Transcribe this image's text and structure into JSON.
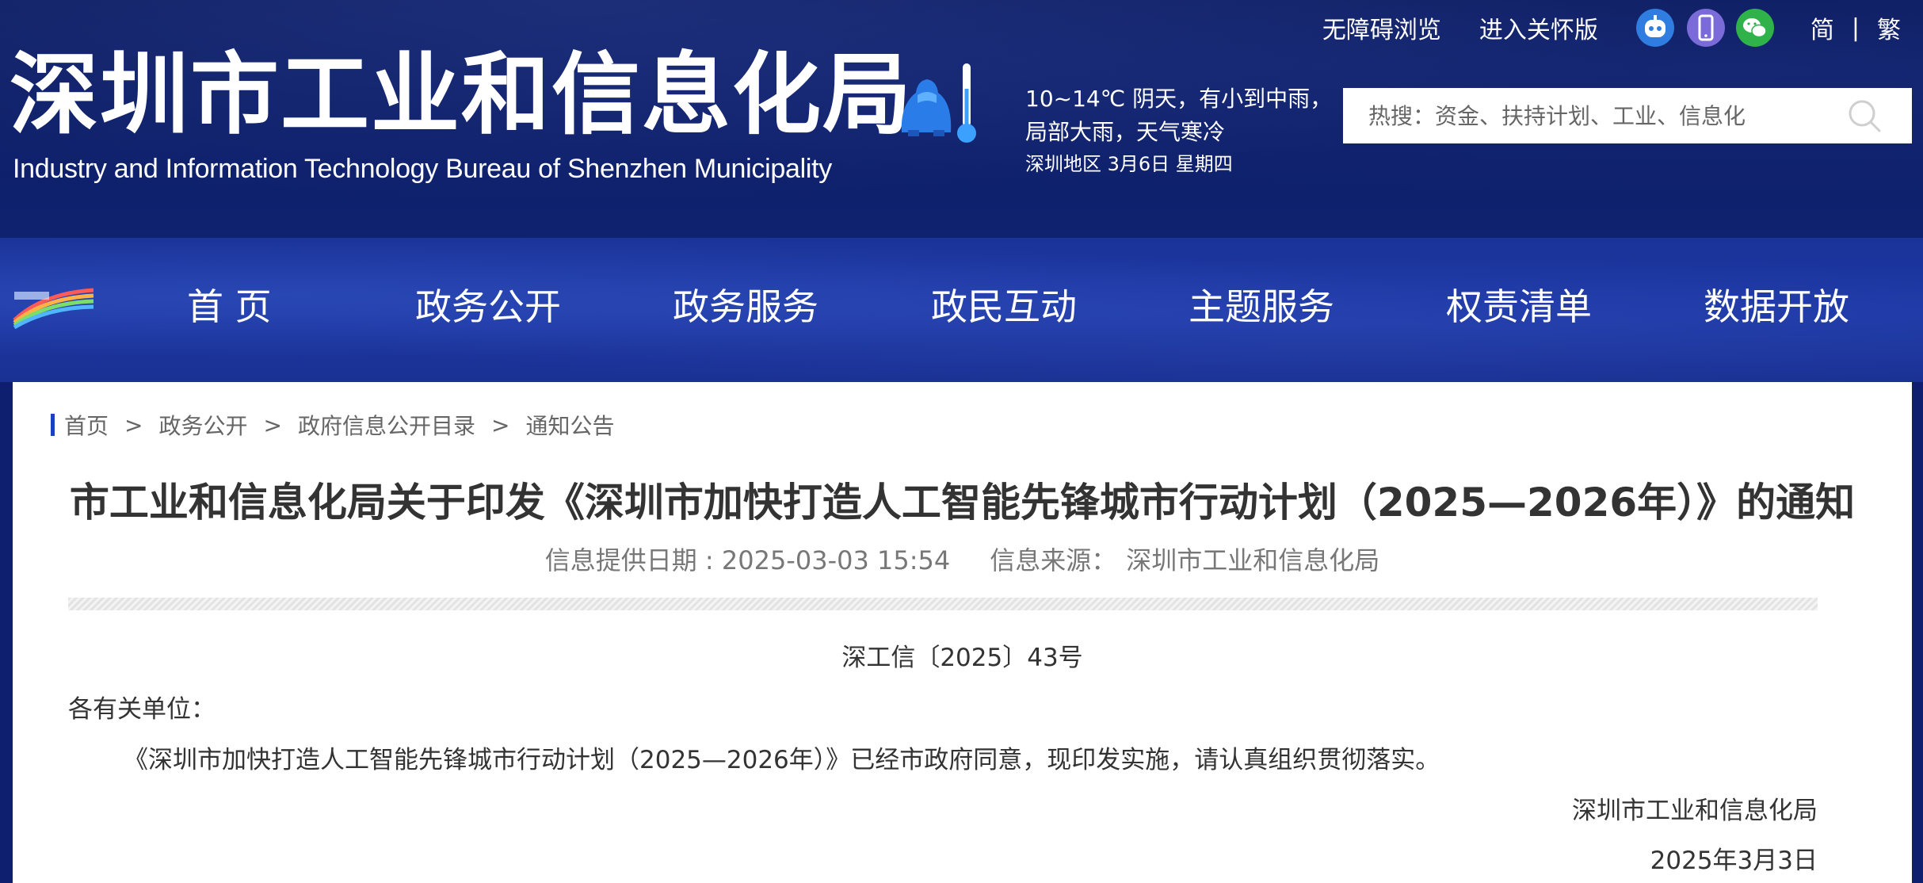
{
  "header": {
    "top_links": {
      "accessibility": "无障碍浏览",
      "elder_mode": "进入关怀版"
    },
    "icons": {
      "robot": "robot-assistant-icon",
      "mobile": "mobile-phone-icon",
      "wechat": "wechat-icon"
    },
    "lang": {
      "simplified": "简",
      "separator": "|",
      "traditional": "繁"
    },
    "title": "深圳市工业和信息化局",
    "subtitle": "Industry and Information Technology Bureau of Shenzhen Municipality",
    "weather": {
      "line1": "10~14℃  阴天，有小到中雨，",
      "line2": "局部大雨，天气寒冷",
      "line3": "深圳地区 3月6日   星期四"
    },
    "search": {
      "placeholder": "热搜：资金、扶持计划、工业、信息化"
    },
    "colors": {
      "header_bg": "#0c1c5e",
      "nav_bg": "#1d37a4",
      "accent": "#1d3fc2"
    }
  },
  "nav": {
    "items": [
      "首 页",
      "政务公开",
      "政务服务",
      "政民互动",
      "主题服务",
      "权责清单",
      "数据开放"
    ]
  },
  "breadcrumb": {
    "items": [
      "首页",
      "政务公开",
      "政府信息公开目录",
      "通知公告"
    ],
    "separator": ">"
  },
  "article": {
    "title": "市工业和信息化局关于印发《深圳市加快打造人工智能先锋城市行动计划（2025—2026年）》的通知",
    "meta": {
      "date_label": "信息提供日期 : 2025-03-03 15:54",
      "source_label": "信息来源：",
      "source": "深圳市工业和信息化局"
    },
    "doc_number": "深工信〔2025〕43号",
    "salutation": "各有关单位：",
    "body": "《深圳市加快打造人工智能先锋城市行动计划（2025—2026年）》已经市政府同意，现印发实施，请认真组织贯彻落实。",
    "signature_org": "深圳市工业和信息化局",
    "signature_date": "2025年3月3日"
  }
}
